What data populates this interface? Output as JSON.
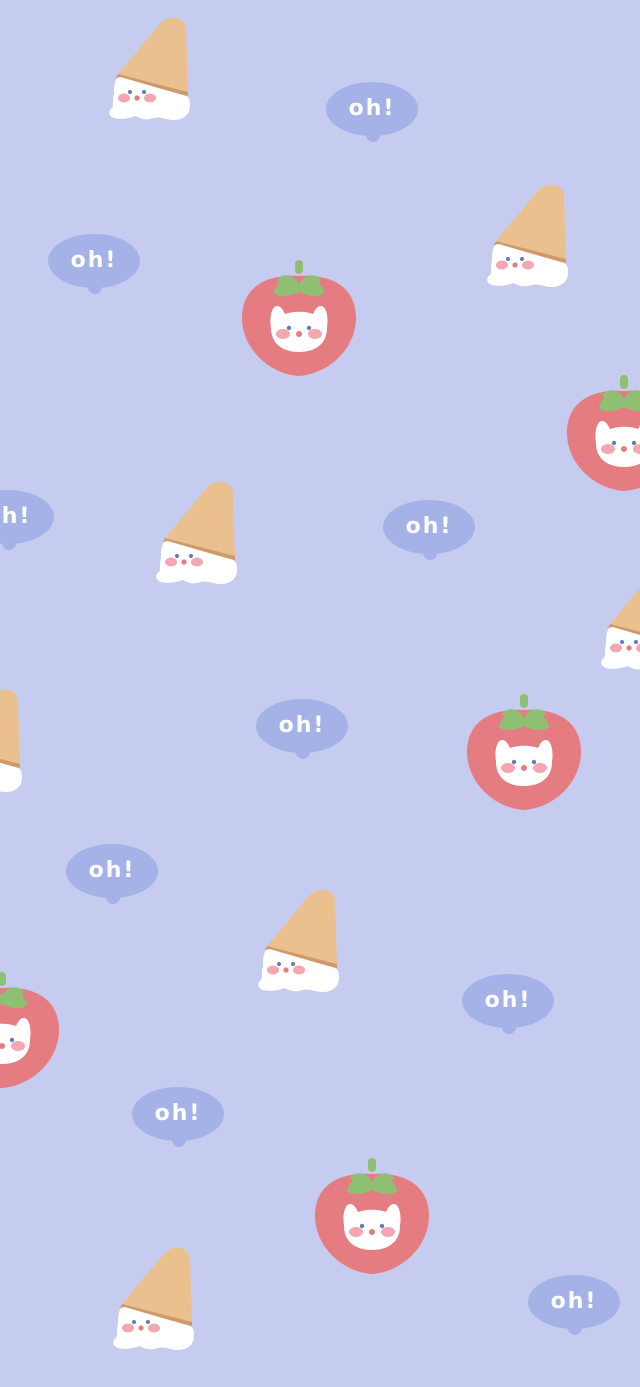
{
  "wallpaper": {
    "background_color": "#c6ccef",
    "bubble_color": "#a4b2e8",
    "strawberry_color": "#e57c82",
    "leaf_color": "#8fbf72",
    "cone_color": "#ebc08f",
    "bubble_text": "oh!"
  }
}
